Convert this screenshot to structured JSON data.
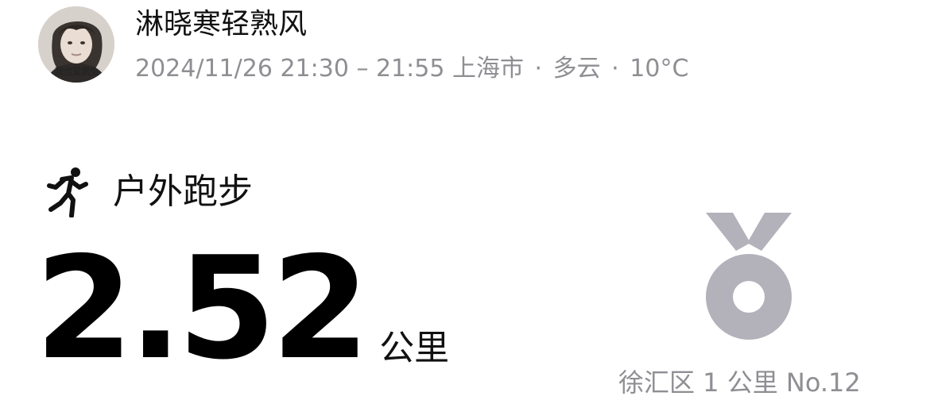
{
  "header": {
    "avatar_caption": "我也爱黑兔",
    "username": "淋晓寒轻熟风",
    "time_range": "2024/11/26 21:30 – 21:55",
    "location": "上海市",
    "separator": "·",
    "weather": "多云",
    "temperature": "10°C"
  },
  "activity": {
    "icon": "running-person-icon",
    "type": "户外跑步",
    "distance_value": "2.52",
    "distance_unit": "公里"
  },
  "achievement": {
    "icon": "medal-icon",
    "rank_text": "徐汇区 1 公里 No.12",
    "medal_color": "#b3b1b9"
  },
  "colors": {
    "primary_text": "#111111",
    "secondary_text": "#8e8e93",
    "background": "#ffffff"
  }
}
